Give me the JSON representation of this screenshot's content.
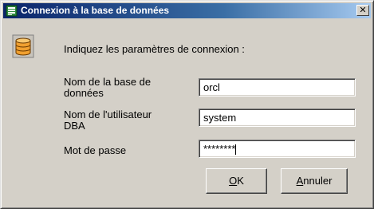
{
  "window": {
    "title": "Connexion à la base de données",
    "close_glyph": "✕"
  },
  "form": {
    "instruction": "Indiquez les paramètres de connexion :",
    "fields": [
      {
        "label": "Nom de la base de données",
        "label_lines": [
          "Nom de la base de",
          "données"
        ],
        "value": "orcl"
      },
      {
        "label": "Nom de l'utilisateur DBA",
        "label_lines": [
          "Nom de l'utilisateur",
          "DBA"
        ],
        "value": "system"
      },
      {
        "label": "Mot de passe",
        "label_lines": [
          "Mot de passe"
        ],
        "value": "********",
        "masked": true
      }
    ]
  },
  "buttons": {
    "ok": {
      "mnemonic": "O",
      "rest": "K"
    },
    "cancel": {
      "mnemonic": "A",
      "rest": "nnuler"
    }
  },
  "icons": {
    "title": "app-icon",
    "main": "database-icon"
  },
  "colors": {
    "titlebar_start": "#0a246a",
    "titlebar_end": "#a6caf0",
    "dialog_bg": "#d4d0c8",
    "db_icon": "#f0a030"
  }
}
